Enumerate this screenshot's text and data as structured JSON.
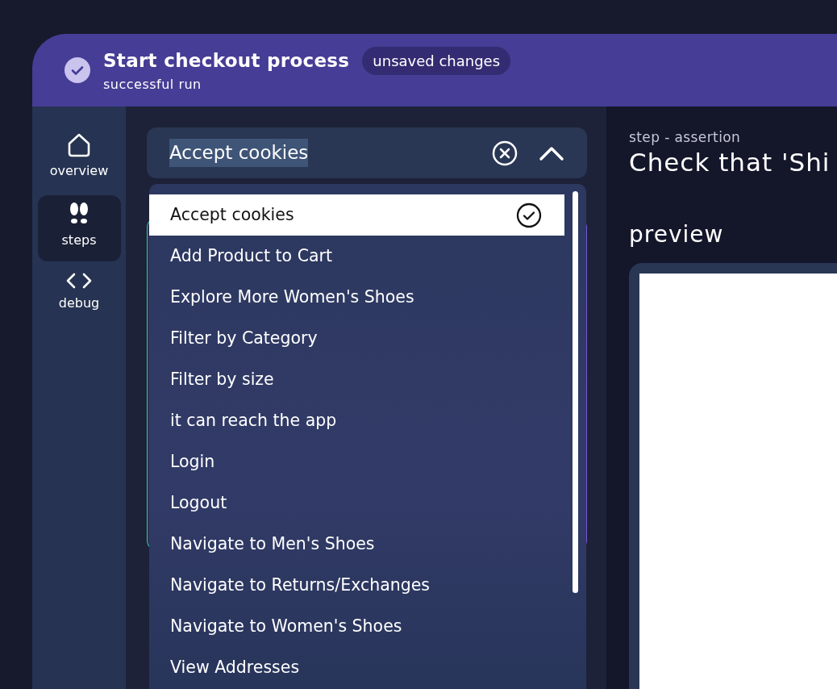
{
  "header": {
    "title": "Start checkout process",
    "badge": "unsaved changes",
    "subtitle": "successful run",
    "kind": "success"
  },
  "sidebar": {
    "items": [
      {
        "label": "overview",
        "kind": "home",
        "selected": false
      },
      {
        "label": "steps",
        "kind": "steps",
        "selected": true
      },
      {
        "label": "debug",
        "kind": "code",
        "selected": false
      }
    ]
  },
  "step_select": {
    "value": "Accept cookies",
    "expanded": true,
    "options": [
      {
        "label": "Accept cookies",
        "selected": true
      },
      {
        "label": "Add Product to Cart",
        "selected": false
      },
      {
        "label": "Explore More Women's Shoes",
        "selected": false
      },
      {
        "label": "Filter by Category",
        "selected": false
      },
      {
        "label": "Filter by size",
        "selected": false
      },
      {
        "label": "it can reach the app",
        "selected": false
      },
      {
        "label": "Login",
        "selected": false
      },
      {
        "label": "Logout",
        "selected": false
      },
      {
        "label": "Navigate to Men's Shoes",
        "selected": false
      },
      {
        "label": "Navigate to Returns/Exchanges",
        "selected": false
      },
      {
        "label": "Navigate to Women's Shoes",
        "selected": false
      },
      {
        "label": "View Addresses",
        "selected": false
      }
    ]
  },
  "detail": {
    "kind_label": "step - assertion",
    "title": "Check that 'Shi",
    "preview_label": "preview"
  }
}
